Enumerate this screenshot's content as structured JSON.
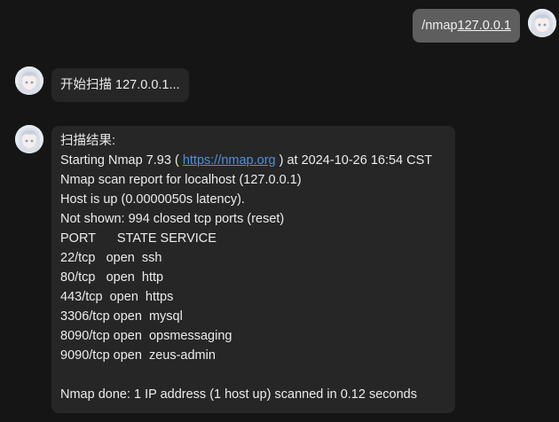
{
  "user_message": {
    "prefix": "/nmap ",
    "link": "127.0.0.1"
  },
  "bot_message_1": {
    "text": "开始扫描 127.0.0.1..."
  },
  "bot_message_2": {
    "heading": "扫描结果:",
    "line_start_a": "Starting Nmap 7.93 ( ",
    "line_start_link": "https://nmap.org",
    "line_start_b": " ) at 2024-10-26 16:54 CST",
    "report": "Nmap scan report for localhost (127.0.0.1)",
    "host_up": "Host is up (0.0000050s latency).",
    "not_shown": "Not shown: 994 closed tcp ports (reset)",
    "header": "PORT      STATE SERVICE",
    "ports": [
      "22/tcp   open  ssh",
      "80/tcp   open  http",
      "443/tcp  open  https",
      "3306/tcp open  mysql",
      "8090/tcp open  opsmessaging",
      "9090/tcp open  zeus-admin"
    ],
    "done": "Nmap done: 1 IP address (1 host up) scanned in 0.12 seconds"
  }
}
